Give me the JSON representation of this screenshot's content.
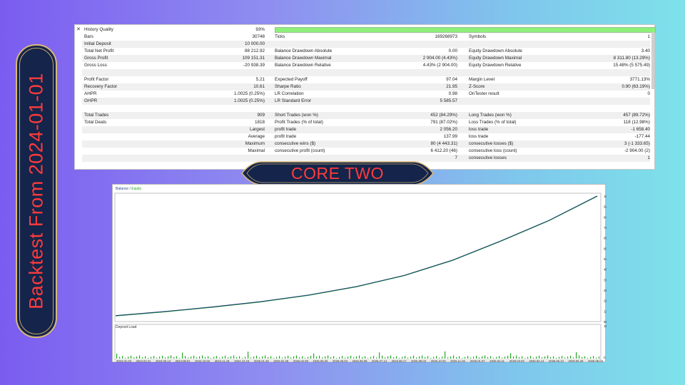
{
  "banner": {
    "text": "Backtest From 2024-01-01",
    "color": "#ff3b3b"
  },
  "title_banner": {
    "text": "CORE TWO"
  },
  "report": {
    "close": "✕",
    "history_quality": {
      "label": "History Quality",
      "value": "93%"
    },
    "rows": [
      {
        "cells": [
          "Bars",
          "30748",
          "Ticks",
          "169268973",
          "Symbols",
          "1"
        ],
        "shade": false
      },
      {
        "cells": [
          "Initial Deposit",
          "10 000.00",
          "",
          "",
          "",
          ""
        ],
        "shade": true
      },
      {
        "cells": [
          "Total Net Profit",
          "88 212.92",
          "Balance Drawdown Absolute",
          "0.00",
          "Equity Drawdown Absolute",
          "3.40"
        ],
        "shade": false
      },
      {
        "cells": [
          "Gross Profit",
          "109 151.31",
          "Balance Drawdown Maximal",
          "2 904.00 (4.43%)",
          "Equity Drawdown Maximal",
          "8 311.80 (13.29%)"
        ],
        "shade": true
      },
      {
        "cells": [
          "Gross Loss",
          "-20 938.39",
          "Balance Drawdown Relative",
          "4.43% (2 904.00)",
          "Equity Drawdown Relative",
          "15.48% (5 575.49)"
        ],
        "shade": false
      },
      {
        "cells": [
          "",
          "",
          "",
          "",
          "",
          ""
        ],
        "shade": true
      },
      {
        "cells": [
          "Profit Factor",
          "5.21",
          "Expected Payoff",
          "97.04",
          "Margin Level",
          "3771.13%"
        ],
        "shade": false
      },
      {
        "cells": [
          "Recovery Factor",
          "10.61",
          "Sharpe Ratio",
          "21.95",
          "Z-Score",
          "0.90 (63.19%)"
        ],
        "shade": true
      },
      {
        "cells": [
          "AHPR",
          "1.0025 (0.25%)",
          "LR Correlation",
          "0.98",
          "OnTester result",
          "0"
        ],
        "shade": false
      },
      {
        "cells": [
          "GHPR",
          "1.0025 (0.25%)",
          "LR Standard Error",
          "5 585.57",
          "",
          ""
        ],
        "shade": true
      },
      {
        "cells": [
          "",
          "",
          "",
          "",
          "",
          ""
        ],
        "shade": false
      },
      {
        "cells": [
          "Total Trades",
          "909",
          "Short Trades (won %)",
          "452 (84.29%)",
          "Long Trades (won %)",
          "457 (89.72%)"
        ],
        "shade": true
      },
      {
        "cells": [
          "Total Deals",
          "1818",
          "Profit Trades (% of total)",
          "791 (87.02%)",
          "Loss Trades (% of total)",
          "118 (12.98%)"
        ],
        "shade": false
      },
      {
        "cells": [
          "",
          "Largest",
          "profit trade",
          "2 056.20",
          "loss trade",
          "-1 658.40"
        ],
        "shade": true
      },
      {
        "cells": [
          "",
          "Average",
          "profit trade",
          "137.99",
          "loss trade",
          "-177.44"
        ],
        "shade": false
      },
      {
        "cells": [
          "",
          "Maximum",
          "consecutive wins ($)",
          "80 (4 443.31)",
          "consecutive losses ($)",
          "3 (-1 333.65)"
        ],
        "shade": true
      },
      {
        "cells": [
          "",
          "Maximal",
          "consecutive profit (count)",
          "6 412.20 (46)",
          "consecutive loss (count)",
          "-2 904.00 (2)"
        ],
        "shade": false
      },
      {
        "cells": [
          "",
          "",
          "",
          "7",
          "consecutive losses",
          "1"
        ],
        "shade": true
      }
    ]
  },
  "chart": {
    "legend_balance": "Balance",
    "legend_sep": " / ",
    "legend_equity": "Equity",
    "deposit_label": "Deposit Load",
    "colors": {
      "balance": "#1a3a78",
      "equity": "#22aa22",
      "deposit": "#22aa22"
    }
  },
  "chart_data": {
    "type": "line",
    "series": [
      {
        "name": "Balance",
        "x": [
          0,
          0.1,
          0.2,
          0.3,
          0.4,
          0.5,
          0.6,
          0.7,
          0.8,
          0.9,
          1.0
        ],
        "values": [
          10000,
          13000,
          16500,
          20500,
          25500,
          32000,
          40500,
          52000,
          66500,
          82000,
          100465
        ]
      },
      {
        "name": "Equity",
        "x": [
          0,
          0.1,
          0.2,
          0.3,
          0.4,
          0.5,
          0.6,
          0.7,
          0.8,
          0.9,
          1.0
        ],
        "values": [
          10000,
          13000,
          16500,
          20500,
          25500,
          32000,
          40500,
          52000,
          66500,
          82000,
          100465
        ]
      }
    ],
    "yticks": [
      "100465",
      "92558",
      "84651",
      "76743",
      "68836",
      "60929",
      "53022",
      "45115",
      "37208",
      "29300",
      "21393",
      "13486",
      "5579"
    ],
    "deposit_ticks": [
      "19.9%",
      "0.4%"
    ],
    "xticks": [
      "2024.01.03",
      "2024.02.21",
      "2024.05.13",
      "2024.08.01",
      "2024.10.04",
      "2024.11.19",
      "2024.12.23",
      "2025.01.30",
      "2025.02.26",
      "2025.04.09",
      "2025.05.03",
      "2025.06.03",
      "2025.06.09",
      "2025.07.14",
      "2025.08.17",
      "2025.09.03",
      "2025.10.03",
      "2025.11.04",
      "2026.01.07",
      "2026.02.11",
      "2026.03.02",
      "2026.04.14",
      "2026.05.13",
      "2026.05.26",
      "2026.06.03"
    ],
    "ylim": [
      5579,
      100465
    ]
  }
}
